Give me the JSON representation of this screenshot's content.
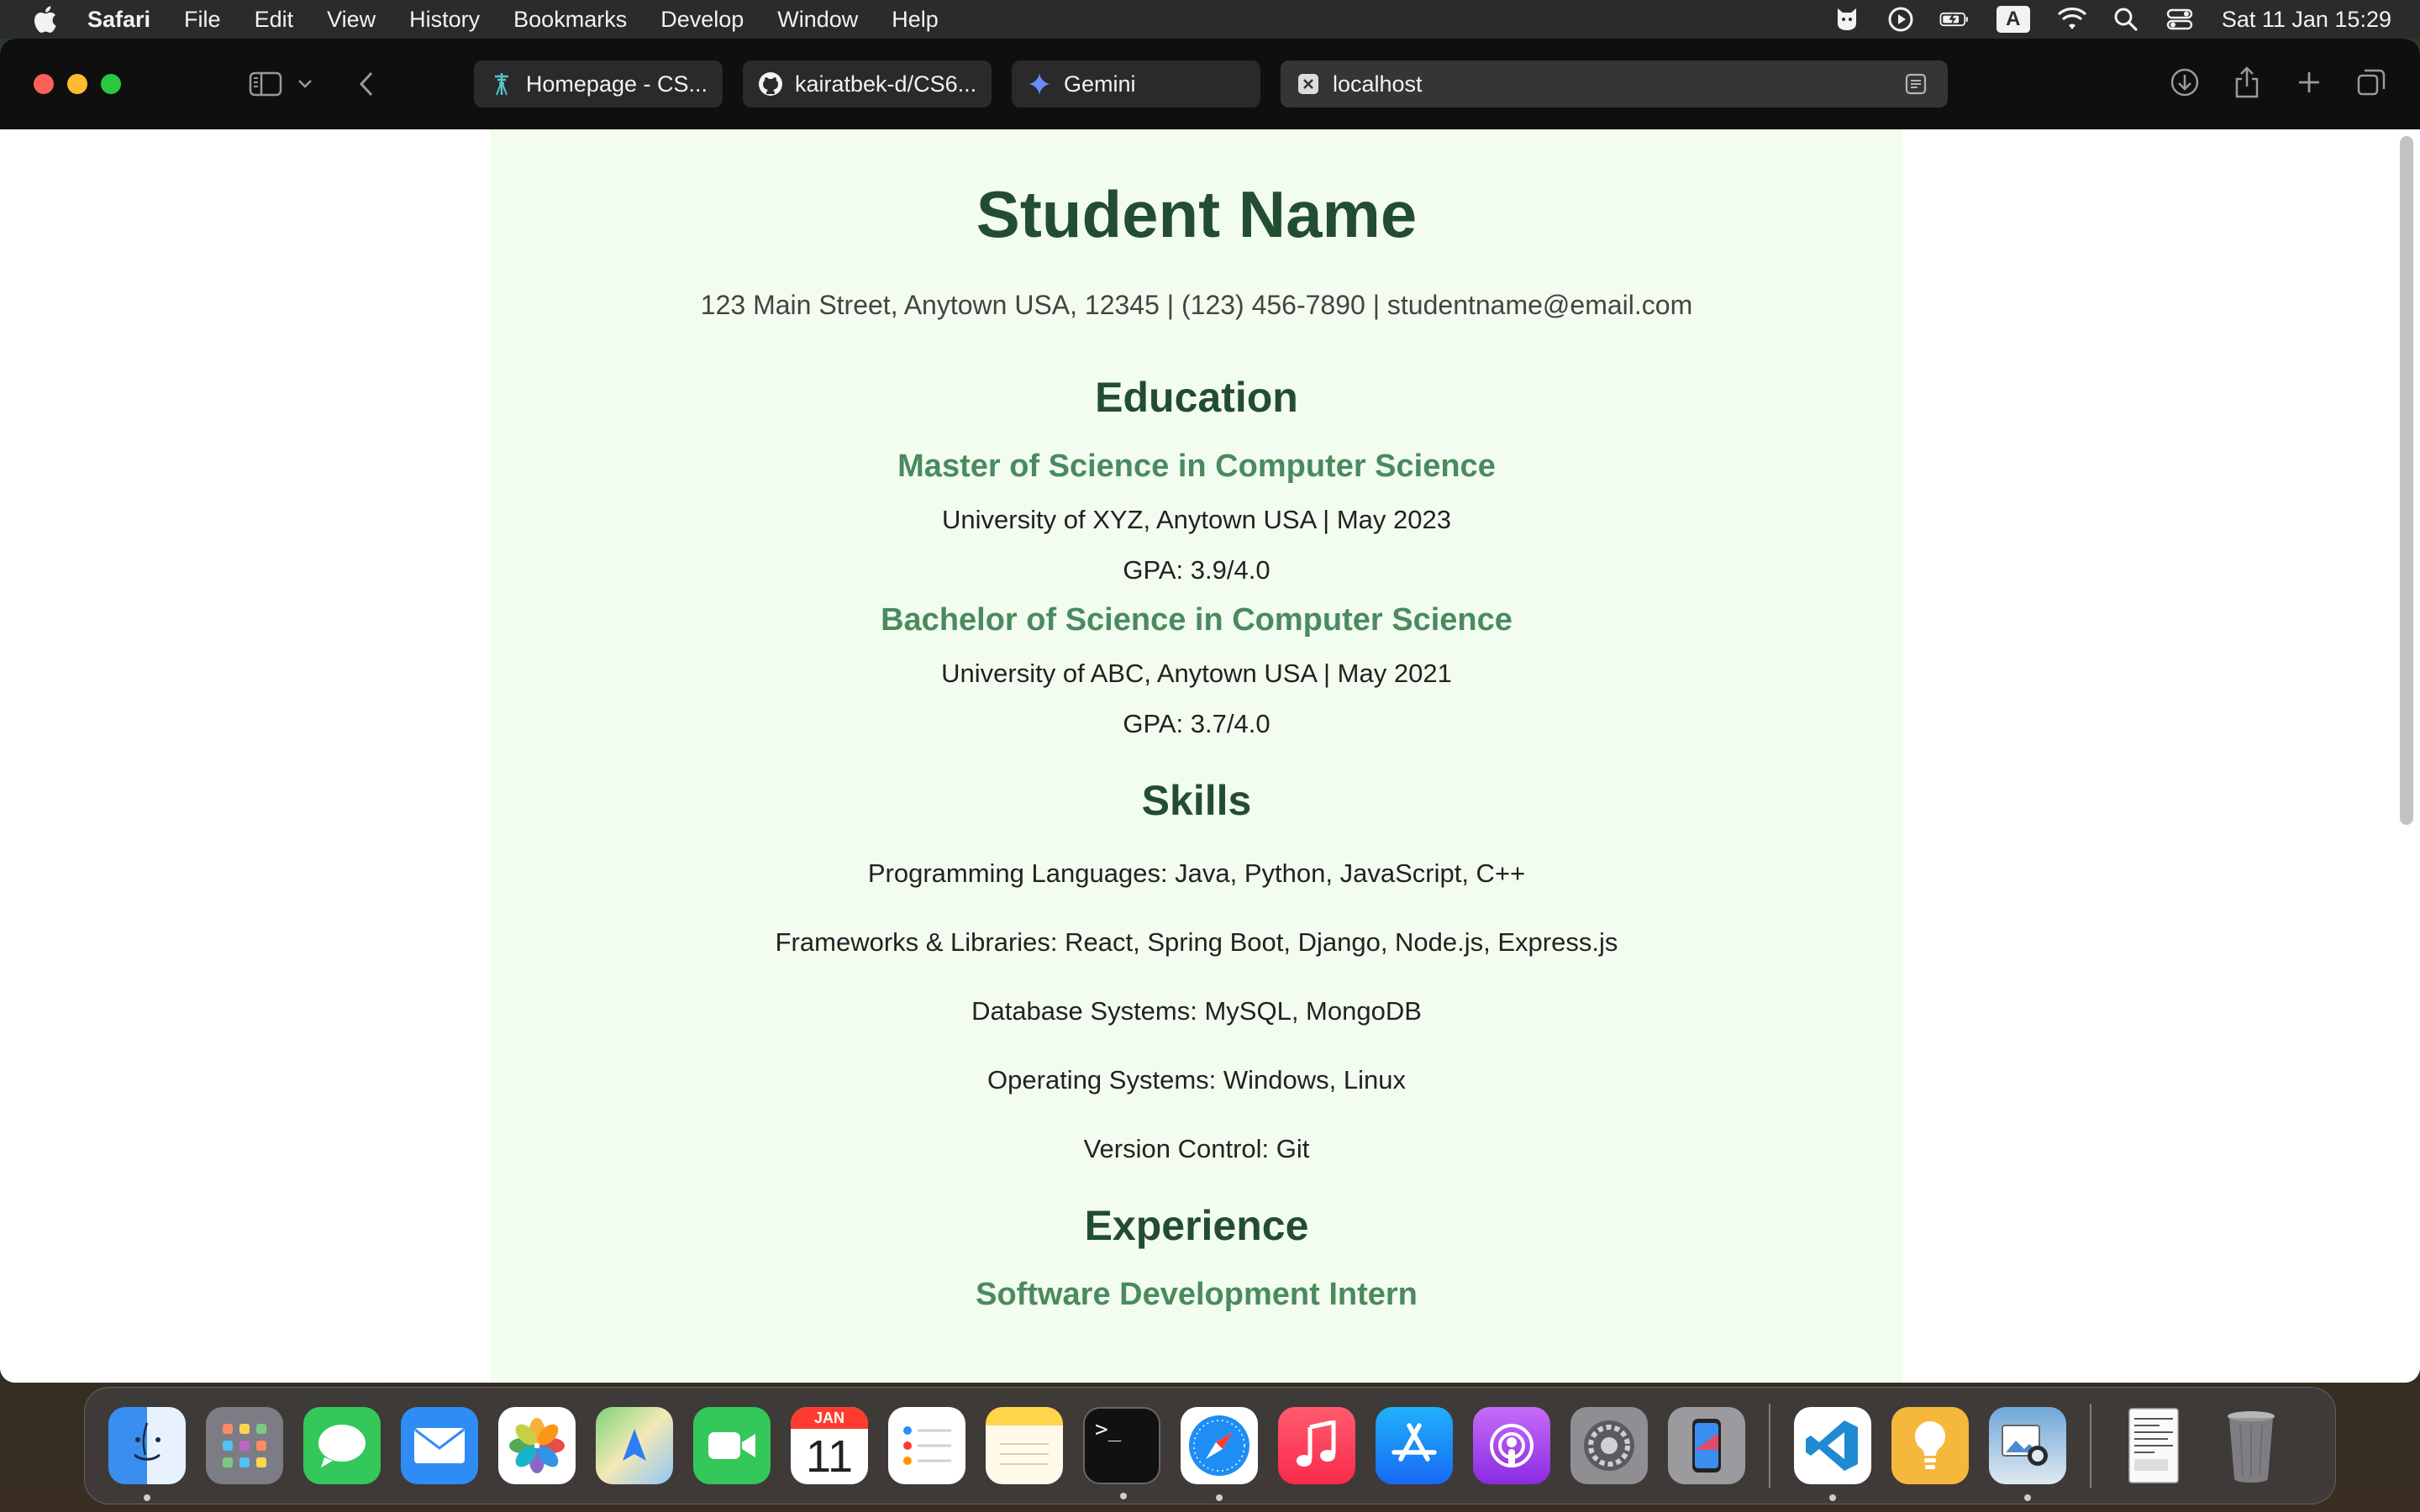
{
  "menubar": {
    "app_name": "Safari",
    "items": [
      "File",
      "Edit",
      "View",
      "History",
      "Bookmarks",
      "Develop",
      "Window",
      "Help"
    ],
    "input_source": "A",
    "clock": "Sat 11 Jan  15:29"
  },
  "browser": {
    "tabs": [
      {
        "label": "Homepage - CS..."
      },
      {
        "label": "kairatbek-d/CS6..."
      },
      {
        "label": "Gemini"
      }
    ],
    "address": "localhost"
  },
  "resume": {
    "name": "Student Name",
    "contact": "123 Main Street, Anytown USA, 12345 | (123) 456-7890 | studentname@email.com",
    "education": {
      "heading": "Education",
      "degrees": [
        {
          "title": "Master of Science in Computer Science",
          "school": "University of XYZ, Anytown USA | May 2023",
          "gpa": "GPA: 3.9/4.0"
        },
        {
          "title": "Bachelor of Science in Computer Science",
          "school": "University of ABC, Anytown USA | May 2021",
          "gpa": "GPA: 3.7/4.0"
        }
      ]
    },
    "skills": {
      "heading": "Skills",
      "items": [
        "Programming Languages: Java, Python, JavaScript, C++",
        "Frameworks & Libraries: React, Spring Boot, Django, Node.js, Express.js",
        "Database Systems: MySQL, MongoDB",
        "Operating Systems: Windows, Linux",
        "Version Control: Git"
      ]
    },
    "experience": {
      "heading": "Experience",
      "first_role": "Software Development Intern"
    }
  },
  "dock": {
    "calendar_month": "JAN",
    "calendar_day": "11",
    "terminal_prompt": ">_"
  },
  "colors": {
    "page_background": "#f2fdf0",
    "heading_dark_green": "#234d30",
    "subheading_green": "#4a8a5e"
  }
}
